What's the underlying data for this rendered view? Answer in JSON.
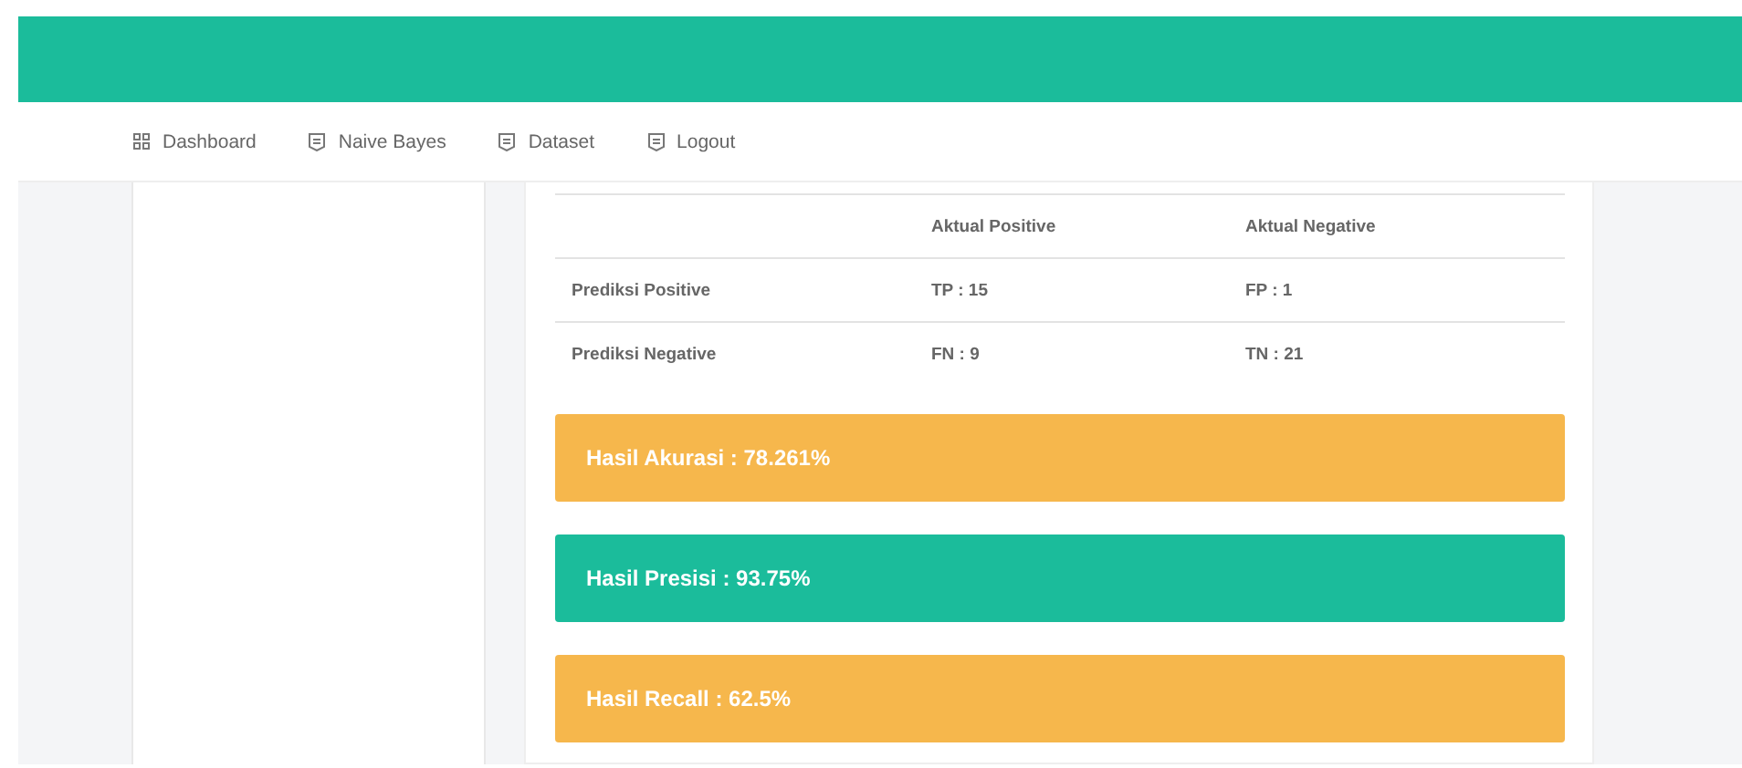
{
  "nav": [
    {
      "label": "Dashboard"
    },
    {
      "label": "Naive Bayes"
    },
    {
      "label": "Dataset"
    },
    {
      "label": "Logout"
    }
  ],
  "table": {
    "columns": [
      "Aktual Positive",
      "Aktual Negative"
    ],
    "rows": [
      {
        "label": "Prediksi Positive",
        "cells": [
          "TP : 15",
          "FP : 1"
        ]
      },
      {
        "label": "Prediksi Negative",
        "cells": [
          "FN : 9",
          "TN : 21"
        ]
      }
    ]
  },
  "results": [
    {
      "text": "Hasil Akurasi : 78.261%",
      "kind": "warning"
    },
    {
      "text": "Hasil Presisi : 93.75%",
      "kind": "success"
    },
    {
      "text": "Hasil Recall : 62.5%",
      "kind": "warning"
    }
  ]
}
